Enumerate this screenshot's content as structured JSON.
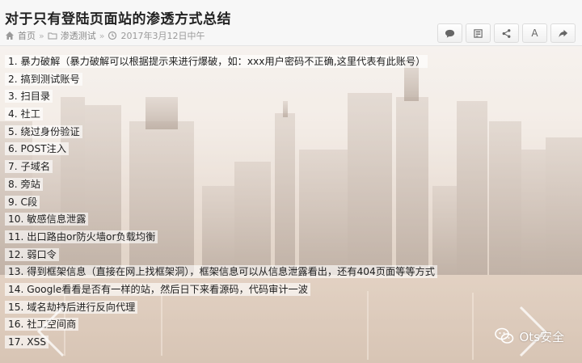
{
  "article": {
    "title": "对于只有登陆页面站的渗透方式总结",
    "breadcrumb": {
      "home": "首页",
      "category": "渗透测试",
      "date": "2017年3月12日中午"
    }
  },
  "toolbar": {
    "buttons": [
      "comment-icon",
      "qrcode-icon",
      "share-icon",
      "font-size-icon",
      "forward-icon"
    ],
    "font_label": "A"
  },
  "items": [
    "1. 暴力破解（暴力破解可以根据提示来进行爆破，如：xxx用户密码不正确,这里代表有此账号）",
    "2. 搞到测试账号",
    "3. 扫目录",
    "4. 社工",
    "5. 绕过身份验证",
    "6. POST注入",
    "7. 子域名",
    "8. 旁站",
    "9. C段",
    "10. 敏感信息泄露",
    "11. 出口路由or防火墙or负载均衡",
    "12. 弱口令",
    "13. 得到框架信息（直接在网上找框架洞），框架信息可以从信息泄露看出，还有404页面等等方式",
    "14. Google看看是否有一样的站，然后日下来看源码，代码审计一波",
    "15. 域名劫持后进行反向代理",
    "16. 社工空间商",
    "17. XSS"
  ],
  "watermark": {
    "text": "Ots安全"
  }
}
